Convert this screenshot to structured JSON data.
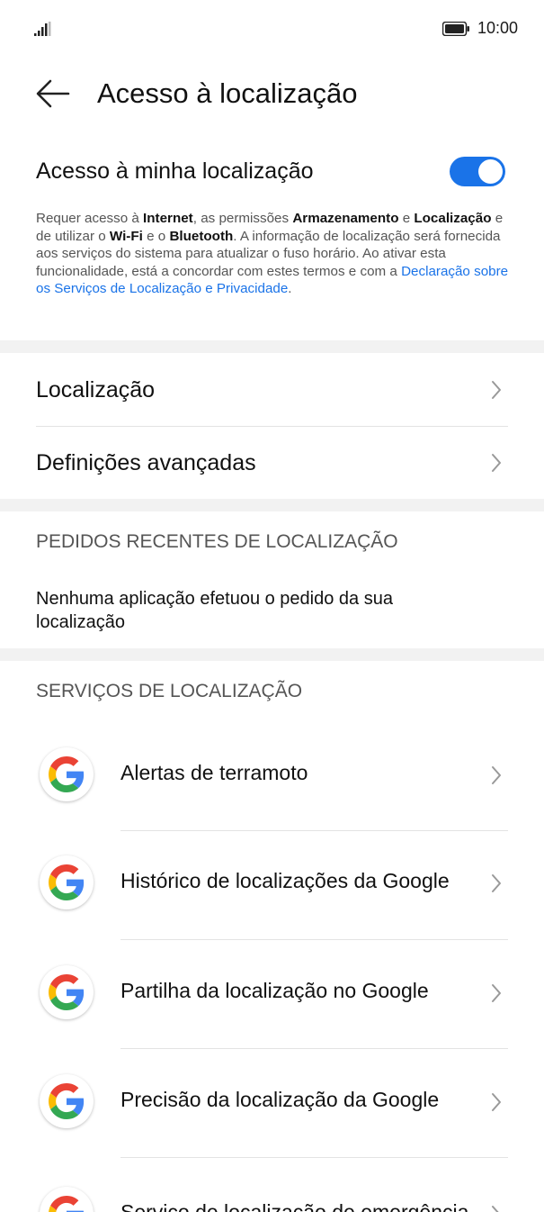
{
  "status_bar": {
    "time": "10:00",
    "signal_icon": "signal-icon",
    "battery_icon": "battery-icon"
  },
  "header": {
    "title": "Acesso à localização",
    "back_icon": "back-arrow-icon"
  },
  "master": {
    "label": "Acesso à minha localização",
    "toggle_on": true
  },
  "description": {
    "p1": "Requer acesso à ",
    "internet": "Internet",
    "p2": ", as permissões ",
    "armazenamento": "Armazenamento",
    "p3": " e ",
    "localizacao": "Localização",
    "p4": " e de utilizar o ",
    "wifi": "Wi-Fi",
    "p5": " e o ",
    "bluetooth": "Bluetooth",
    "p6": ". A informação de localização será fornecida aos serviços do sistema para atualizar o fuso horário. Ao ativar esta funcionalidade, está a concordar com estes termos e com a ",
    "link": "Declaração sobre os Serviços de Localização e Privacidade",
    "p7": "."
  },
  "menu": [
    {
      "label": "Localização"
    },
    {
      "label": "Definições avançadas"
    }
  ],
  "recent": {
    "header": "PEDIDOS RECENTES DE LOCALIZAÇÃO",
    "text": "Nenhuma aplicação efetuou o pedido da sua localização"
  },
  "services": {
    "header": "SERVIÇOS DE LOCALIZAÇÃO",
    "items": [
      {
        "label": "Alertas de terramoto",
        "icon": "google-icon"
      },
      {
        "label": "Histórico de localizações da Google",
        "icon": "google-icon"
      },
      {
        "label": "Partilha da localização no Google",
        "icon": "google-icon"
      },
      {
        "label": "Precisão da localização da Google",
        "icon": "google-icon"
      },
      {
        "label": "Serviço de localização de emergência",
        "icon": "google-icon"
      }
    ]
  },
  "colors": {
    "accent": "#1a73e8",
    "section_gap": "#f2f2f2"
  }
}
